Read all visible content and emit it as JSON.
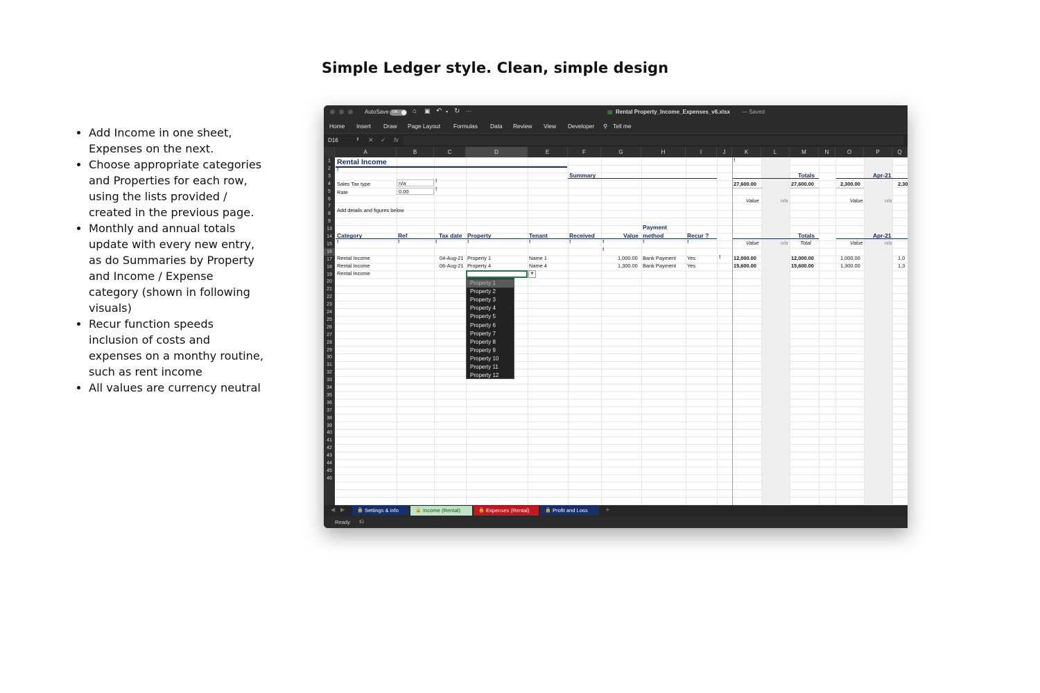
{
  "headline": "Simple Ledger style. Clean, simple design",
  "bullets": [
    "Add Income in one sheet, Expenses on the next.",
    "Choose appropriate categories and Properties for each row, using the lists provided / created in the previous page.",
    "Monthly and annual totals update with every new entry, as do Summaries by Property and Income / Expense category (shown in following visuals)",
    "Recur function speeds inclusion of costs and expenses on a monthy routine, such as rent income",
    "All values are currency neutral"
  ],
  "window": {
    "autosave_label": "AutoSave",
    "autosave_state": "ON",
    "more": "···",
    "filename": "Rental Property_Income_Expenses_v6.xlsx",
    "saved": "— Saved",
    "ribbon": [
      "Home",
      "Insert",
      "Draw",
      "Page Layout",
      "Formulas",
      "Data",
      "Review",
      "View",
      "Developer",
      "Tell me"
    ],
    "name_box": "D16",
    "fx": "fx"
  },
  "columns": [
    "A",
    "B",
    "C",
    "D",
    "E",
    "F",
    "G",
    "H",
    "I",
    "J",
    "K",
    "L",
    "M",
    "N",
    "O",
    "P",
    "Q"
  ],
  "rows": [
    "1",
    "2",
    "3",
    "4",
    "5",
    "6",
    "7",
    "8",
    "9",
    "13",
    "14",
    "15",
    "16",
    "17",
    "18",
    "19",
    "20",
    "21",
    "22",
    "23",
    "24",
    "25",
    "26",
    "27",
    "28",
    "29",
    "30",
    "31",
    "32",
    "33",
    "34",
    "35",
    "36",
    "37",
    "38",
    "39",
    "40",
    "41",
    "42",
    "43",
    "44",
    "45",
    "46"
  ],
  "sheet": {
    "title": "Rental Income",
    "excl": "!",
    "summary_label": "Summary",
    "totals_label": "Totals",
    "month_label": "Apr-21",
    "sales_tax_label": "Sales Tax type",
    "sales_tax_value": "n/a",
    "rate_label": "Rate",
    "rate_value": "0.00",
    "summary_total_k": "27,600.00",
    "summary_total_m": "27,600.00",
    "summary_total_o": "2,300.00",
    "summary_total_q": "2,30",
    "value_label": "Value",
    "na_label": "n/a",
    "total_label": "Total",
    "instructions": "Add details and figures below",
    "headers": {
      "category": "Category",
      "ref": "Ref",
      "tax_date": "Tax date",
      "property": "Property",
      "tenant": "Tenant",
      "received": "Received",
      "value": "Value",
      "payment_1": "Payment",
      "payment_2": "method",
      "recur": "Recur ?"
    },
    "entries": [
      {
        "category": "Rental Income",
        "tax_date": "04-Aug-21",
        "property": "Property 1",
        "tenant": "Name 1",
        "value": "1,000.00",
        "method": "Bank Payment",
        "recur": "Yes",
        "k": "12,000.00",
        "m": "12,000.00",
        "o": "1,000.00",
        "q": "1,0"
      },
      {
        "category": "Rental Income",
        "tax_date": "06-Aug-21",
        "property": "Property 4",
        "tenant": "Name 4",
        "value": "1,300.00",
        "method": "Bank Payment",
        "recur": "Yes",
        "k": "15,600.00",
        "m": "15,600.00",
        "o": "1,300.00",
        "q": "1,3"
      }
    ],
    "active_row_category": "Rental Income"
  },
  "dropdown": [
    "Property 1",
    "Property 2",
    "Property 3",
    "Property 4",
    "Property 5",
    "Property 6",
    "Property 7",
    "Property 8",
    "Property 9",
    "Property 10",
    "Property 11",
    "Property 12"
  ],
  "tabs": [
    {
      "label": "Settings & info",
      "color": "#17306b"
    },
    {
      "label": "Income (Rental)",
      "color": "#bfe3c4"
    },
    {
      "label": "Expenses (Rental)",
      "color": "#c8161d"
    },
    {
      "label": "Profit and Loss",
      "color": "#17306b"
    }
  ],
  "add_sheet": "+",
  "status": "Ready"
}
